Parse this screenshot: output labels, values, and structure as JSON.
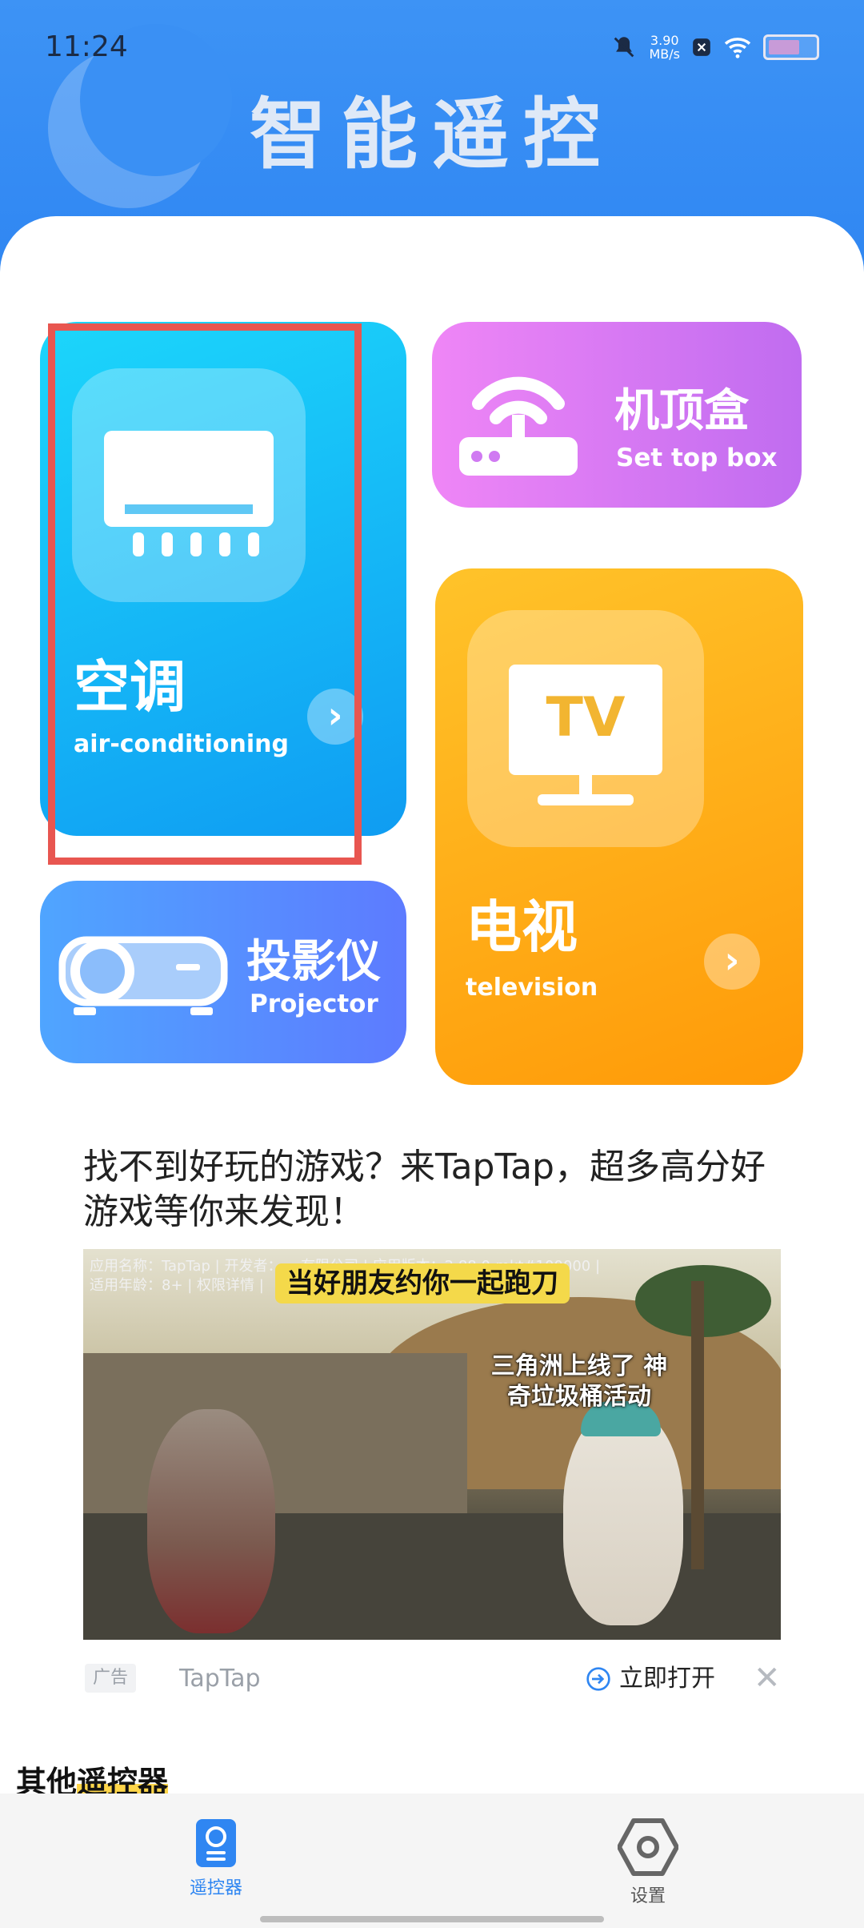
{
  "status_bar": {
    "time": "11:24",
    "net_speed_value": "3.90",
    "net_speed_unit": "MB/s"
  },
  "header": {
    "title": "智能遥控"
  },
  "cards": {
    "air_conditioning": {
      "title": "空调",
      "subtitle": "air-conditioning",
      "arrow": "›"
    },
    "set_top_box": {
      "title": "机顶盒",
      "subtitle": "Set top box"
    },
    "projector": {
      "title": "投影仪",
      "subtitle": "Projector"
    },
    "television": {
      "title": "电视",
      "subtitle": "television",
      "arrow": "›",
      "screen_text": "TV"
    }
  },
  "ad": {
    "title": "找不到好玩的游戏？来TapTap，超多高分好游戏等你来发现！",
    "meta_line1": "应用名称：TapTap | 开发者：… 有限公司 | 应用版本：2.88.0-mkt#100000 |",
    "meta_line2": "适用年龄：8+ | 权限详情 |",
    "banner": "当好朋友约你一起跑刀",
    "caption": "三角洲上线了 神奇垃圾桶活动",
    "badge": "广告",
    "brand": "TapTap",
    "open_label": "立即打开",
    "close_label": "✕"
  },
  "section": {
    "title_prefix": "其他",
    "title_highlight": "遥控器"
  },
  "bottom_nav": {
    "remote_label": "遥控器",
    "settings_label": "设置"
  },
  "colors": {
    "header_blue": "#2f86f2",
    "ac_card": "#0f9cf2",
    "stb_card": "#c06cf0",
    "tv_card": "#ff9a08",
    "projector_card": "#5d7bff",
    "highlight_red": "#e85650",
    "active_nav": "#2f86f2"
  },
  "icons": {
    "ac": "air-conditioner-icon",
    "stb": "router-icon",
    "tv": "tv-icon",
    "projector": "projector-icon",
    "remote": "remote-icon",
    "settings": "hexagon-gear-icon"
  }
}
